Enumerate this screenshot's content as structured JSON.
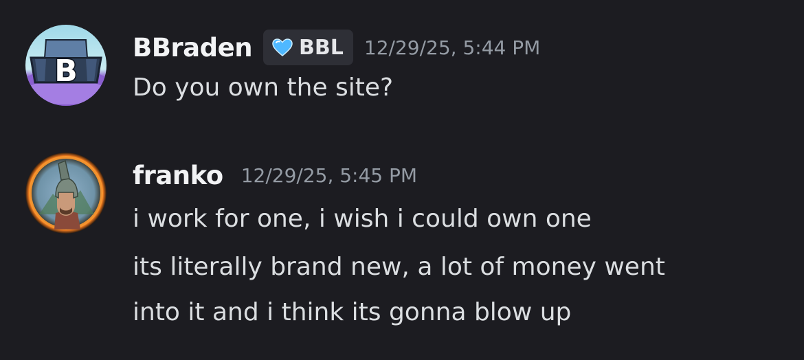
{
  "messages": [
    {
      "username": "BBraden",
      "avatar": "avatar-bb-letter",
      "tag": {
        "icon": "blue-heart-icon",
        "label": "BBL",
        "color": "#4fb8ff"
      },
      "timestamp": "12/29/25, 5:44 PM",
      "lines": [
        "Do you own the site?"
      ]
    },
    {
      "username": "franko",
      "avatar": "avatar-helmet-warrior",
      "timestamp": "12/29/25, 5:45 PM",
      "lines": [
        "i work for one, i wish i could own one",
        "its literally brand new, a lot of money went",
        "into it and i think its gonna blow up"
      ]
    }
  ],
  "colors": {
    "background": "#1c1c21",
    "username": "#f2f3f5",
    "text": "#dbdee1",
    "timestamp": "#949ba4",
    "tag_bg": "#2e2f36",
    "avatar_ring": "#e8761c"
  }
}
